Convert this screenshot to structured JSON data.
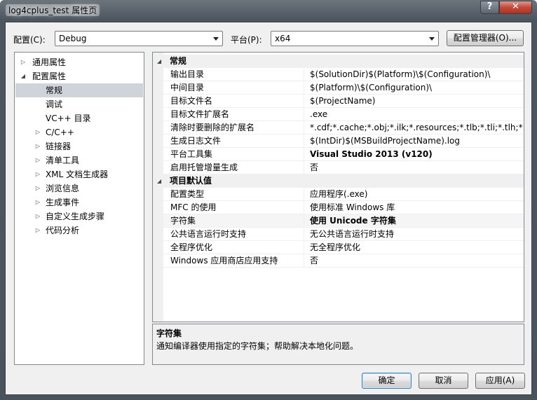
{
  "window": {
    "title": "log4cplus_test 属性页"
  },
  "toolbar": {
    "config_label": "配置(C):",
    "config_value": "Debug",
    "platform_label": "平台(P):",
    "platform_value": "x64",
    "config_manager_label": "配置管理器(O)..."
  },
  "tree": {
    "items": [
      {
        "label": "通用属性",
        "expander": "▷"
      },
      {
        "label": "配置属性",
        "expander": "◢"
      },
      {
        "label": "常规",
        "expander": ""
      },
      {
        "label": "调试",
        "expander": ""
      },
      {
        "label": "VC++ 目录",
        "expander": ""
      },
      {
        "label": "C/C++",
        "expander": "▷"
      },
      {
        "label": "链接器",
        "expander": "▷"
      },
      {
        "label": "清单工具",
        "expander": "▷"
      },
      {
        "label": "XML 文档生成器",
        "expander": "▷"
      },
      {
        "label": "浏览信息",
        "expander": "▷"
      },
      {
        "label": "生成事件",
        "expander": "▷"
      },
      {
        "label": "自定义生成步骤",
        "expander": "▷"
      },
      {
        "label": "代码分析",
        "expander": "▷"
      }
    ]
  },
  "grid": {
    "categories": [
      {
        "name": "常规",
        "rows": [
          {
            "name": "输出目录",
            "value": "$(SolutionDir)$(Platform)\\$(Configuration)\\"
          },
          {
            "name": "中间目录",
            "value": "$(Platform)\\$(Configuration)\\"
          },
          {
            "name": "目标文件名",
            "value": "$(ProjectName)"
          },
          {
            "name": "目标文件扩展名",
            "value": ".exe"
          },
          {
            "name": "清除时要删除的扩展名",
            "value": "*.cdf;*.cache;*.obj;*.ilk;*.resources;*.tlb;*.tli;*.tlh;*.tmp;*"
          },
          {
            "name": "生成日志文件",
            "value": "$(IntDir)$(MSBuildProjectName).log"
          },
          {
            "name": "平台工具集",
            "value": "Visual Studio 2013 (v120)"
          },
          {
            "name": "启用托管增量生成",
            "value": "否"
          }
        ]
      },
      {
        "name": "项目默认值",
        "rows": [
          {
            "name": "配置类型",
            "value": "应用程序(.exe)"
          },
          {
            "name": "MFC 的使用",
            "value": "使用标准 Windows 库"
          },
          {
            "name": "字符集",
            "value": "使用 Unicode 字符集"
          },
          {
            "name": "公共语言运行时支持",
            "value": "无公共语言运行时支持"
          },
          {
            "name": "全程序优化",
            "value": "无全程序优化"
          },
          {
            "name": "Windows 应用商店应用支持",
            "value": "否"
          }
        ]
      }
    ]
  },
  "description": {
    "title": "字符集",
    "text": "通知编译器使用指定的字符集；帮助解决本地化问题。"
  },
  "buttons": {
    "ok": "确定",
    "cancel": "取消",
    "apply": "应用(A)"
  },
  "icons": {
    "help": "help-icon",
    "close": "close-icon"
  }
}
